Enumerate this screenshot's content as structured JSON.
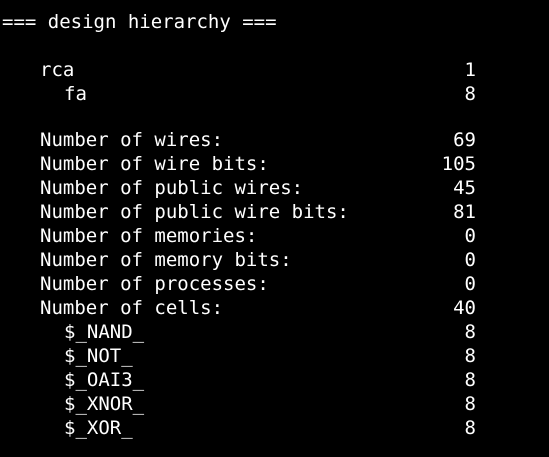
{
  "header": "=== design hierarchy ===",
  "hierarchy": [
    {
      "name": "rca",
      "count": "1"
    },
    {
      "name": "fa",
      "count": "8"
    }
  ],
  "stats": [
    {
      "label": "Number of wires:",
      "value": "69"
    },
    {
      "label": "Number of wire bits:",
      "value": "105"
    },
    {
      "label": "Number of public wires:",
      "value": "45"
    },
    {
      "label": "Number of public wire bits:",
      "value": "81"
    },
    {
      "label": "Number of memories:",
      "value": "0"
    },
    {
      "label": "Number of memory bits:",
      "value": "0"
    },
    {
      "label": "Number of processes:",
      "value": "0"
    },
    {
      "label": "Number of cells:",
      "value": "40"
    }
  ],
  "cells": [
    {
      "type": "$_NAND_",
      "count": "8"
    },
    {
      "type": "$_NOT_",
      "count": "8"
    },
    {
      "type": "$_OAI3_",
      "count": "8"
    },
    {
      "type": "$_XNOR_",
      "count": "8"
    },
    {
      "type": "$_XOR_",
      "count": "8"
    }
  ]
}
